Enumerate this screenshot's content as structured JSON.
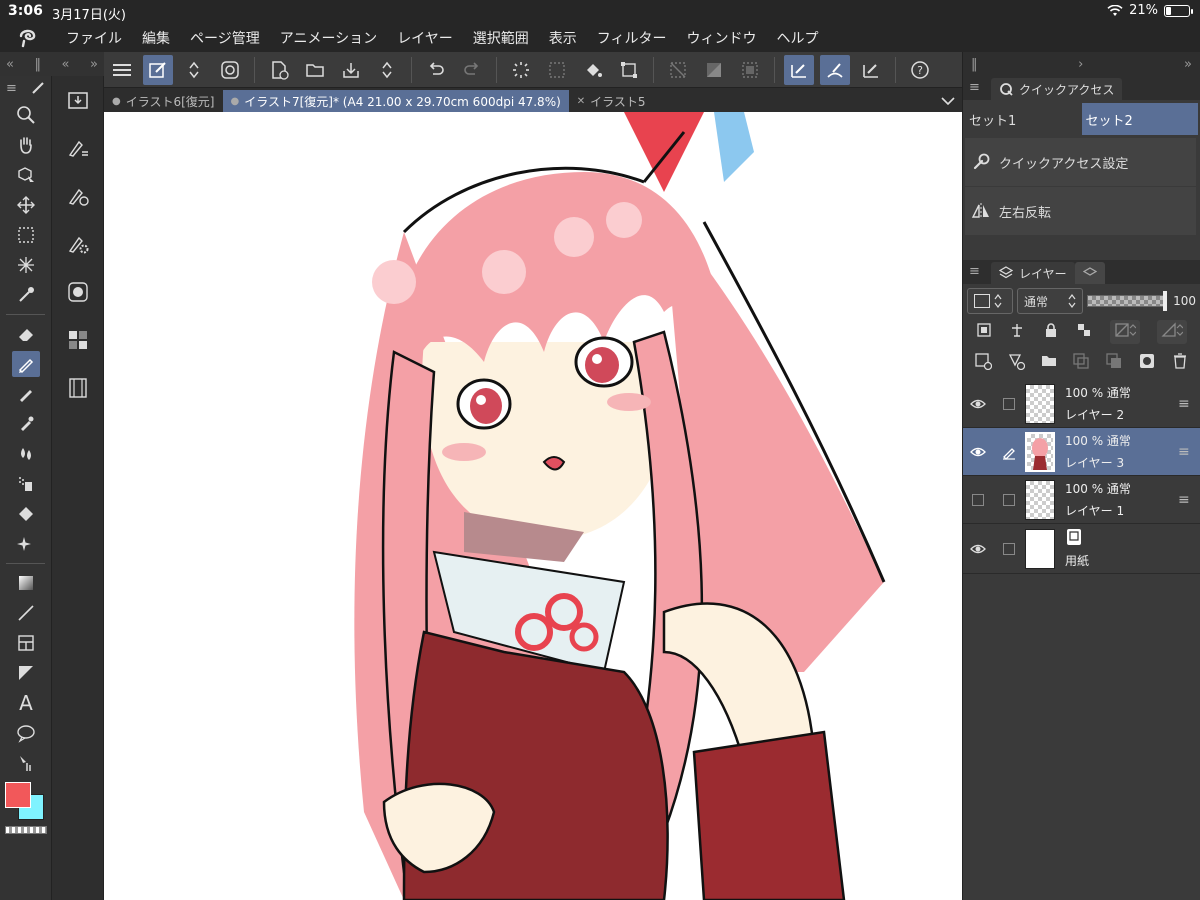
{
  "status": {
    "time": "3:06",
    "date": "3月17日(火)",
    "battery": "21%",
    "battery_level": 0.21
  },
  "menu": [
    "ファイル",
    "編集",
    "ページ管理",
    "アニメーション",
    "レイヤー",
    "選択範囲",
    "表示",
    "フィルター",
    "ウィンドウ",
    "ヘルプ"
  ],
  "tabs": [
    {
      "label": "イラスト6[復元]",
      "active": false
    },
    {
      "label": "イラスト7[復元]* (A4 21.00 x 29.70cm 600dpi 47.8%)",
      "active": true
    },
    {
      "label": "イラスト5",
      "active": false
    }
  ],
  "quick_access": {
    "title": "クイックアクセス",
    "sets": [
      "セット1",
      "セット2"
    ],
    "items": [
      {
        "label": "クイックアクセス設定",
        "icon": "wrench-icon"
      },
      {
        "label": "左右反転",
        "icon": "flip-horizontal-icon"
      }
    ]
  },
  "layers_panel": {
    "title": "レイヤー",
    "blend_mode": "通常",
    "opacity": "100",
    "layers": [
      {
        "mode": "100 % 通常",
        "name": "レイヤー 2",
        "visible": true,
        "selected": false,
        "editing": false,
        "paper": false
      },
      {
        "mode": "100 % 通常",
        "name": "レイヤー 3",
        "visible": true,
        "selected": true,
        "editing": true,
        "paper": false
      },
      {
        "mode": "100 % 通常",
        "name": "レイヤー 1",
        "visible": false,
        "selected": false,
        "editing": false,
        "paper": false
      },
      {
        "mode": "",
        "name": "用紙",
        "visible": true,
        "selected": false,
        "editing": false,
        "paper": true
      }
    ]
  },
  "colors": {
    "main": "#f2585a",
    "sub": "#7ff3ff",
    "accent": "#5a6f96"
  }
}
